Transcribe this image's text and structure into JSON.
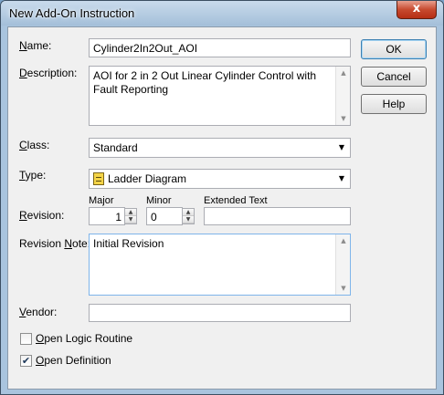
{
  "window": {
    "title": "New Add-On Instruction",
    "close_glyph": "x"
  },
  "labels": {
    "name_pre": "",
    "name_u": "N",
    "name_post": "ame:",
    "description_pre": "",
    "description_u": "D",
    "description_post": "escription:",
    "class_pre": "",
    "class_u": "C",
    "class_post": "lass:",
    "type_pre": "",
    "type_u": "T",
    "type_post": "ype:",
    "revision_pre": "",
    "revision_u": "R",
    "revision_post": "evision:",
    "revision_note_pre": "Revision ",
    "revision_note_u": "N",
    "revision_note_post": "ote:",
    "vendor_pre": "",
    "vendor_u": "V",
    "vendor_post": "endor:",
    "major": "Major",
    "minor": "Minor",
    "extended_text": "Extended Text"
  },
  "fields": {
    "name": "Cylinder2In2Out_AOI",
    "description": "AOI for 2 in 2 Out Linear Cylinder Control with Fault Reporting",
    "class": "Standard",
    "type": "Ladder Diagram",
    "type_icon": "ladder-diagram-icon",
    "major": "1",
    "minor": "0",
    "extended_text": "",
    "revision_note": "Initial Revision",
    "vendor": ""
  },
  "buttons": {
    "ok": "OK",
    "cancel": "Cancel",
    "help": "Help"
  },
  "checkboxes": {
    "open_logic_pre": "",
    "open_logic_u": "O",
    "open_logic_post": "pen Logic Routine",
    "open_logic_checked": false,
    "open_def_pre": "",
    "open_def_u": "O",
    "open_def_post": "pen Definition",
    "open_def_checked": true
  }
}
